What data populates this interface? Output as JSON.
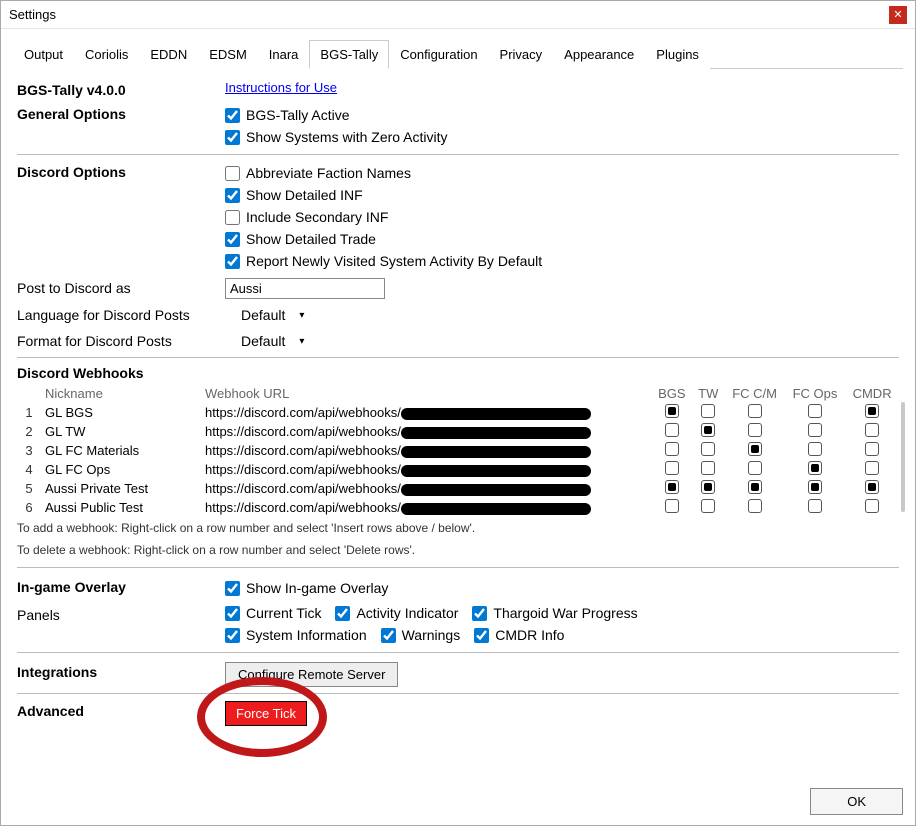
{
  "window": {
    "title": "Settings"
  },
  "tabs": [
    "Output",
    "Coriolis",
    "EDDN",
    "EDSM",
    "Inara",
    "BGS-Tally",
    "Configuration",
    "Privacy",
    "Appearance",
    "Plugins"
  ],
  "active_tab": 5,
  "header": {
    "product": "BGS-Tally v4.0.0",
    "instructions_link": "Instructions for Use"
  },
  "general": {
    "title": "General Options",
    "opts": [
      {
        "label": "BGS-Tally Active",
        "checked": true
      },
      {
        "label": "Show Systems with Zero Activity",
        "checked": true
      }
    ]
  },
  "discord": {
    "title": "Discord Options",
    "opts": [
      {
        "label": "Abbreviate Faction Names",
        "checked": false
      },
      {
        "label": "Show Detailed INF",
        "checked": true
      },
      {
        "label": "Include Secondary INF",
        "checked": false
      },
      {
        "label": "Show Detailed Trade",
        "checked": true
      },
      {
        "label": "Report Newly Visited System Activity By Default",
        "checked": true
      }
    ],
    "post_as_label": "Post to Discord as",
    "post_as_value": "Aussi",
    "lang_label": "Language for Discord Posts",
    "lang_value": "Default",
    "fmt_label": "Format for Discord Posts",
    "fmt_value": "Default"
  },
  "webhooks": {
    "title": "Discord Webhooks",
    "headers": [
      "",
      "Nickname",
      "Webhook URL",
      "BGS",
      "TW",
      "FC C/M",
      "FC Ops",
      "CMDR"
    ],
    "rows": [
      {
        "n": 1,
        "nick": "GL BGS",
        "url": "https://discord.com/api/webhooks/",
        "c": [
          true,
          false,
          false,
          false,
          true
        ]
      },
      {
        "n": 2,
        "nick": "GL TW",
        "url": "https://discord.com/api/webhooks/",
        "c": [
          false,
          true,
          false,
          false,
          false
        ]
      },
      {
        "n": 3,
        "nick": "GL FC Materials",
        "url": "https://discord.com/api/webhooks/",
        "c": [
          false,
          false,
          true,
          false,
          false
        ]
      },
      {
        "n": 4,
        "nick": "GL FC Ops",
        "url": "https://discord.com/api/webhooks/",
        "c": [
          false,
          false,
          false,
          true,
          false
        ]
      },
      {
        "n": 5,
        "nick": "Aussi Private Test",
        "url": "https://discord.com/api/webhooks/",
        "c": [
          true,
          true,
          true,
          true,
          true
        ]
      },
      {
        "n": 6,
        "nick": "Aussi Public Test",
        "url": "https://discord.com/api/webhooks/",
        "c": [
          false,
          false,
          false,
          false,
          false
        ]
      }
    ],
    "hint_add": "To add a webhook: Right-click on a row number and select 'Insert rows above / below'.",
    "hint_del": "To delete a webhook: Right-click on a row number and select 'Delete rows'."
  },
  "overlay": {
    "title": "In-game Overlay",
    "show": {
      "label": "Show In-game Overlay",
      "checked": true
    },
    "panels_label": "Panels",
    "panels1": [
      {
        "label": "Current Tick",
        "checked": true
      },
      {
        "label": "Activity Indicator",
        "checked": true
      },
      {
        "label": "Thargoid War Progress",
        "checked": true
      }
    ],
    "panels2": [
      {
        "label": "System Information",
        "checked": true
      },
      {
        "label": "Warnings",
        "checked": true
      },
      {
        "label": "CMDR Info",
        "checked": true
      }
    ]
  },
  "integrations": {
    "title": "Integrations",
    "button": "Configure Remote Server"
  },
  "advanced": {
    "title": "Advanced",
    "button": "Force Tick"
  },
  "footer": {
    "ok": "OK"
  }
}
